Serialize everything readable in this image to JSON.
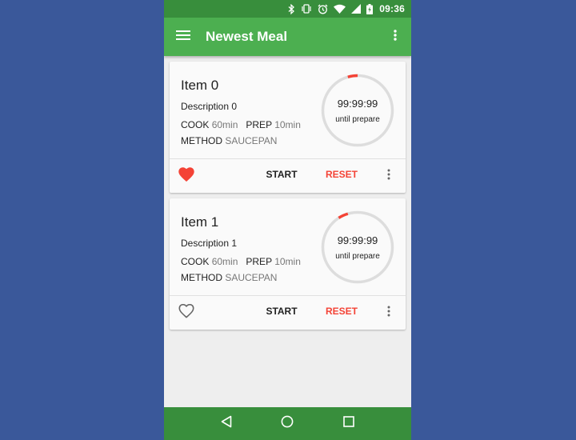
{
  "status_bar": {
    "time": "09:36",
    "icons": [
      "bluetooth-icon",
      "vibrate-icon",
      "alarm-icon",
      "wifi-icon",
      "signal-icon",
      "battery-charging-icon"
    ]
  },
  "toolbar": {
    "title": "Newest Meal",
    "menu_icon": "hamburger-menu-icon",
    "overflow_icon": "more-vert-icon",
    "color": "#4caf50"
  },
  "cards": [
    {
      "name": "Item 0",
      "description": "Description 0",
      "cook_label": "COOK",
      "cook_value": "60min",
      "prep_label": "PREP",
      "prep_value": "10min",
      "method_label": "METHOD",
      "method_value": "SAUCEPAN",
      "timer_value": "99:99:99",
      "timer_caption": "until prepare",
      "favorite": true,
      "start_label": "START",
      "reset_label": "RESET"
    },
    {
      "name": "Item 1",
      "description": "Description 1",
      "cook_label": "COOK",
      "cook_value": "60min",
      "prep_label": "PREP",
      "prep_value": "10min",
      "method_label": "METHOD",
      "method_value": "SAUCEPAN",
      "timer_value": "99:99:99",
      "timer_caption": "until prepare",
      "favorite": false,
      "start_label": "START",
      "reset_label": "RESET"
    }
  ],
  "nav_bar": {
    "icons": [
      "back-icon",
      "home-icon",
      "recents-icon"
    ],
    "color": "#388e3c"
  },
  "colors": {
    "accent_red": "#f44336",
    "primary_dark": "#388e3c",
    "background_outer": "#3a589a"
  }
}
